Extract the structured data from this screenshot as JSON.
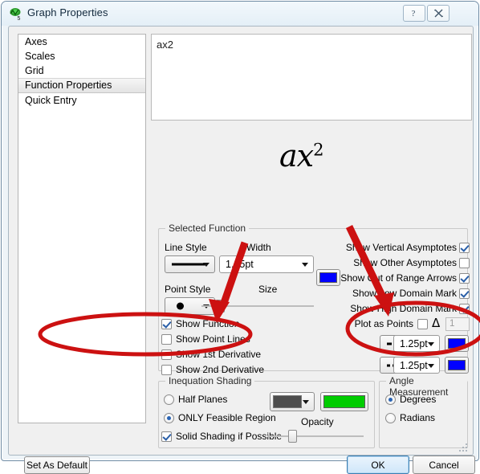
{
  "window": {
    "title": "Graph Properties",
    "app_icon": "graph-app-icon",
    "help_button": "?",
    "close_button": "✖"
  },
  "sidebar": {
    "items": [
      {
        "label": "Axes",
        "selected": false
      },
      {
        "label": "Scales",
        "selected": false
      },
      {
        "label": "Grid",
        "selected": false
      },
      {
        "label": "Function Properties",
        "selected": true
      },
      {
        "label": "Quick Entry",
        "selected": false
      }
    ]
  },
  "function_editor": {
    "value": "ax2",
    "preview_base": "ax",
    "preview_exponent": "2"
  },
  "selected_function": {
    "group_label": "Selected Function",
    "line_style_label": "Line Style",
    "line_style_value": "solid-line",
    "width_label": "Width",
    "width_value": "1.25pt",
    "color_value": "#0000FF",
    "point_style_label": "Point Style",
    "point_style_value": "filled-circle",
    "size_label": "Size",
    "size_percent": 22,
    "checkboxes": [
      {
        "label": "Show Function",
        "checked": true
      },
      {
        "label": "Show Point Lines",
        "checked": false
      },
      {
        "label": "Show  1st Derivative",
        "checked": false
      },
      {
        "label": "Show 2nd Derivative",
        "checked": false
      }
    ],
    "right_checkboxes": [
      {
        "label": "Show Vertical Asymptotes",
        "checked": true
      },
      {
        "label": "Show Other Asymptotes",
        "checked": false
      },
      {
        "label": "Show Out of Range Arrows",
        "checked": true
      },
      {
        "label": "Show Low Domain Mark",
        "checked": true
      },
      {
        "label": "Show High Domain Mark",
        "checked": true
      }
    ],
    "plot_as_points": {
      "label": "Plot as Points",
      "checked": false,
      "delta_symbol": "Δ",
      "delta_value": "1"
    },
    "derivative_rows": [
      {
        "style": "dashed-line",
        "width": "1.25pt",
        "color": "#0000FF"
      },
      {
        "style": "dotted-line",
        "width": "1.25pt",
        "color": "#0000FF"
      }
    ]
  },
  "inequation_shading": {
    "group_label": "Inequation Shading",
    "radios": [
      {
        "label": "Half Planes",
        "selected": false
      },
      {
        "label": "ONLY Feasible Region",
        "selected": true
      }
    ],
    "solid_shading": {
      "label": "Solid Shading if Possible",
      "checked": true
    },
    "shade_color": "#4d4d4d",
    "fill_color": "#00CC00",
    "opacity_label": "Opacity",
    "opacity_percent": 25
  },
  "angle_measurement": {
    "group_label": "Angle Measurement",
    "radios": [
      {
        "label": "Degrees",
        "selected": true
      },
      {
        "label": "Radians",
        "selected": false
      }
    ]
  },
  "footer": {
    "set_as_default": "Set As Default",
    "ok": "OK",
    "cancel": "Cancel"
  },
  "annotations": {
    "color": "#CC1111",
    "arrow_1": "arrow-pointing-to-derivative-checkboxes",
    "arrow_2": "arrow-pointing-to-derivative-line-styles",
    "ellipse_1": "ellipse-around-derivative-checkboxes",
    "ellipse_2": "ellipse-around-derivative-line-style-rows"
  }
}
